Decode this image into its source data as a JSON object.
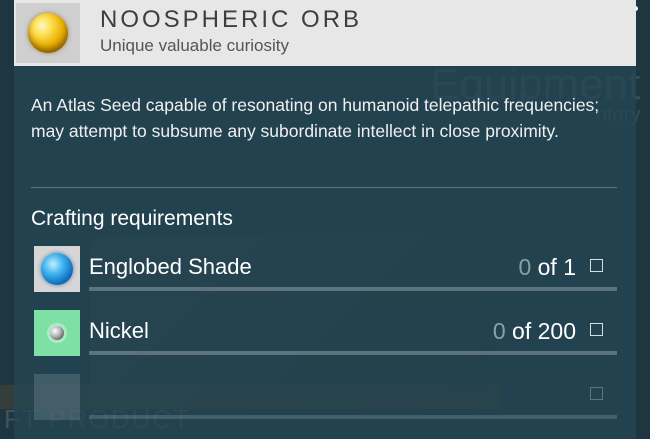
{
  "background": {
    "heading": "Equipment",
    "subheading": "ntory",
    "footer": "FT PRODUCT"
  },
  "item": {
    "icon": "golden-orb-icon",
    "title": "NOOSPHERIC ORB",
    "subtitle": "Unique valuable curiosity",
    "description": "An Atlas Seed capable of resonating on humanoid telepathic frequencies; may attempt to subsume any subordinate intellect in close proximity."
  },
  "crafting": {
    "label": "Crafting requirements",
    "requirements": [
      {
        "name": "Englobed Shade",
        "have": "0",
        "of_label": "of",
        "need": "1",
        "icon": "englobed-shade-icon"
      },
      {
        "name": "Nickel",
        "have": "0",
        "of_label": "of",
        "need": "200",
        "icon": "nickel-icon"
      }
    ]
  },
  "colors": {
    "panel": "#264652",
    "header": "#e7e7e7",
    "nickel_icon_bg": "#7fe0a6"
  }
}
